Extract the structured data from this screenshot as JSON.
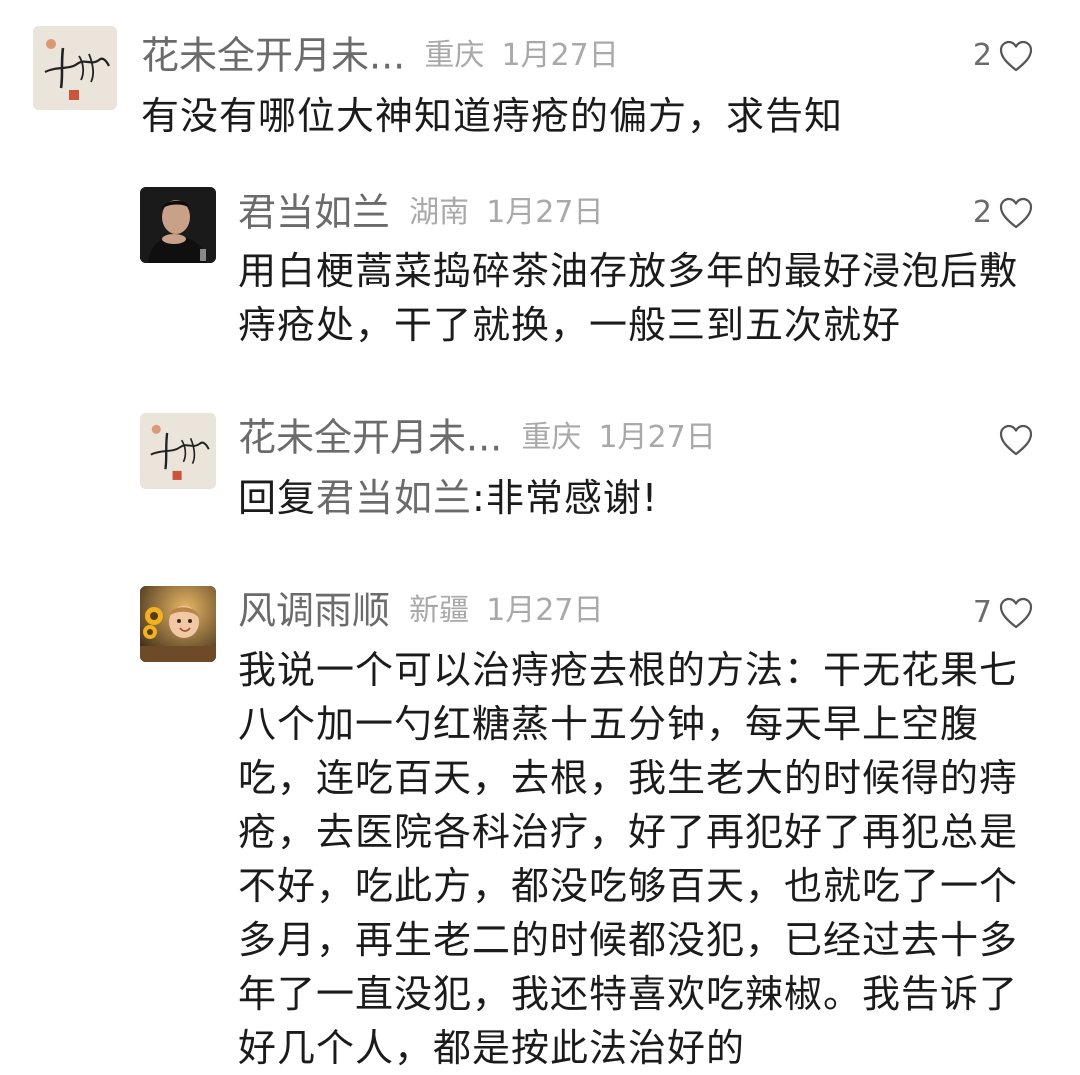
{
  "comments": [
    {
      "username": "花未全开月未...",
      "location": "重庆",
      "date": "1月27日",
      "likes": "2",
      "text": "有没有哪位大神知道痔疮的偏方，求告知",
      "avatar_icon": "calligraphy-logo-icon"
    },
    {
      "username": "君当如兰",
      "location": "湖南",
      "date": "1月27日",
      "likes": "2",
      "text": "用白梗蒿菜捣碎茶油存放多年的最好浸泡后敷痔疮处，干了就换，一般三到五次就好",
      "avatar_icon": "person-photo-icon"
    },
    {
      "username": "花未全开月未...",
      "location": "重庆",
      "date": "1月27日",
      "likes": "",
      "reply_prefix": "回复",
      "reply_to": "君当如兰",
      "text": ":非常感谢!",
      "avatar_icon": "calligraphy-logo-icon"
    },
    {
      "username": "风调雨顺",
      "location": "新疆",
      "date": "1月27日",
      "likes": "7",
      "text": "我说一个可以治痔疮去根的方法：干无花果七八个加一勺红糖蒸十五分钟，每天早上空腹吃，连吃百天，去根，我生老大的时候得的痔疮，去医院各科治疗，好了再犯好了再犯总是不好，吃此方，都没吃够百天，也就吃了一个多月，再生老二的时候都没犯，已经过去十多年了一直没犯，我还特喜欢吃辣椒。我告诉了好几个人，都是按此法治好的",
      "avatar_icon": "child-sunflower-photo-icon"
    }
  ],
  "colors": {
    "username": "#6b6b6b",
    "meta": "#a9a9a9",
    "text": "#1b1b1b",
    "heart_outline": "#555555"
  }
}
